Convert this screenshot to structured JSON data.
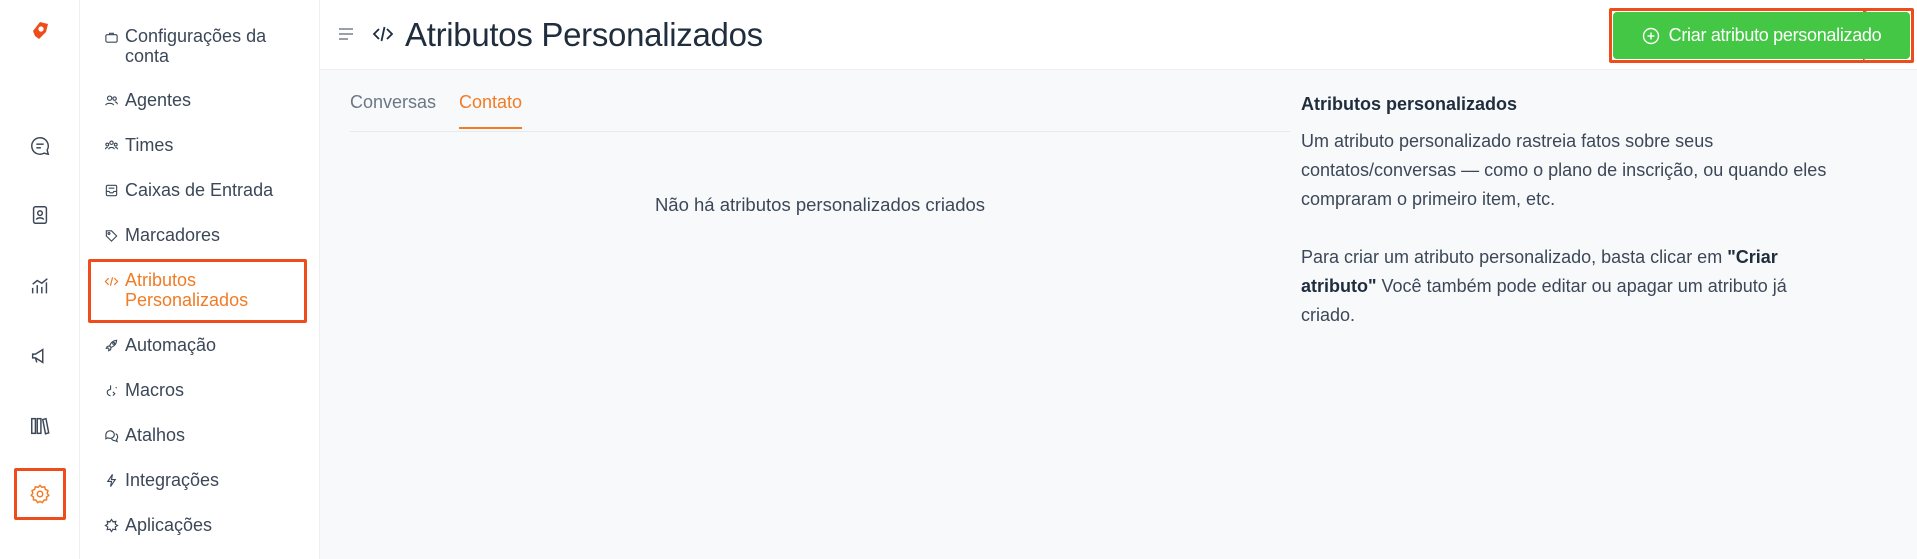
{
  "header": {
    "title": "Atributos Personalizados",
    "create_button": "Criar atributo personalizado"
  },
  "rail": {
    "items": [
      "logo-icon",
      "chat-icon",
      "contacts-icon",
      "reports-icon",
      "campaigns-icon",
      "library-icon",
      "settings-icon"
    ]
  },
  "nav": {
    "items": [
      {
        "label": "Configurações da conta",
        "icon": "briefcase-icon"
      },
      {
        "label": "Agentes",
        "icon": "people-icon"
      },
      {
        "label": "Times",
        "icon": "team-icon"
      },
      {
        "label": "Caixas de Entrada",
        "icon": "inbox-icon"
      },
      {
        "label": "Marcadores",
        "icon": "tag-icon"
      },
      {
        "label": "Atributos Personalizados",
        "icon": "code-icon"
      },
      {
        "label": "Automação",
        "icon": "rocket-icon"
      },
      {
        "label": "Macros",
        "icon": "macro-icon"
      },
      {
        "label": "Atalhos",
        "icon": "chat-bubbles-icon"
      },
      {
        "label": "Integrações",
        "icon": "flash-icon"
      },
      {
        "label": "Aplicações",
        "icon": "apps-icon"
      }
    ]
  },
  "tabs": [
    {
      "label": "Conversas"
    },
    {
      "label": "Contato"
    }
  ],
  "empty_state": "Não há atributos personalizados criados",
  "aside": {
    "title": "Atributos personalizados",
    "p1": "Um atributo personalizado rastreia fatos sobre seus contatos/conversas — como o plano de inscrição, ou quando eles compraram o primeiro item, etc.",
    "p2_before": "Para criar um atributo personalizado, basta clicar em ",
    "p2_bold": "\"Criar atributo\"",
    "p2_after": " Você também pode editar ou apagar um atributo já criado."
  },
  "colors": {
    "accent": "#f07c26",
    "highlight": "#ef4c1c",
    "button": "#44c744"
  }
}
